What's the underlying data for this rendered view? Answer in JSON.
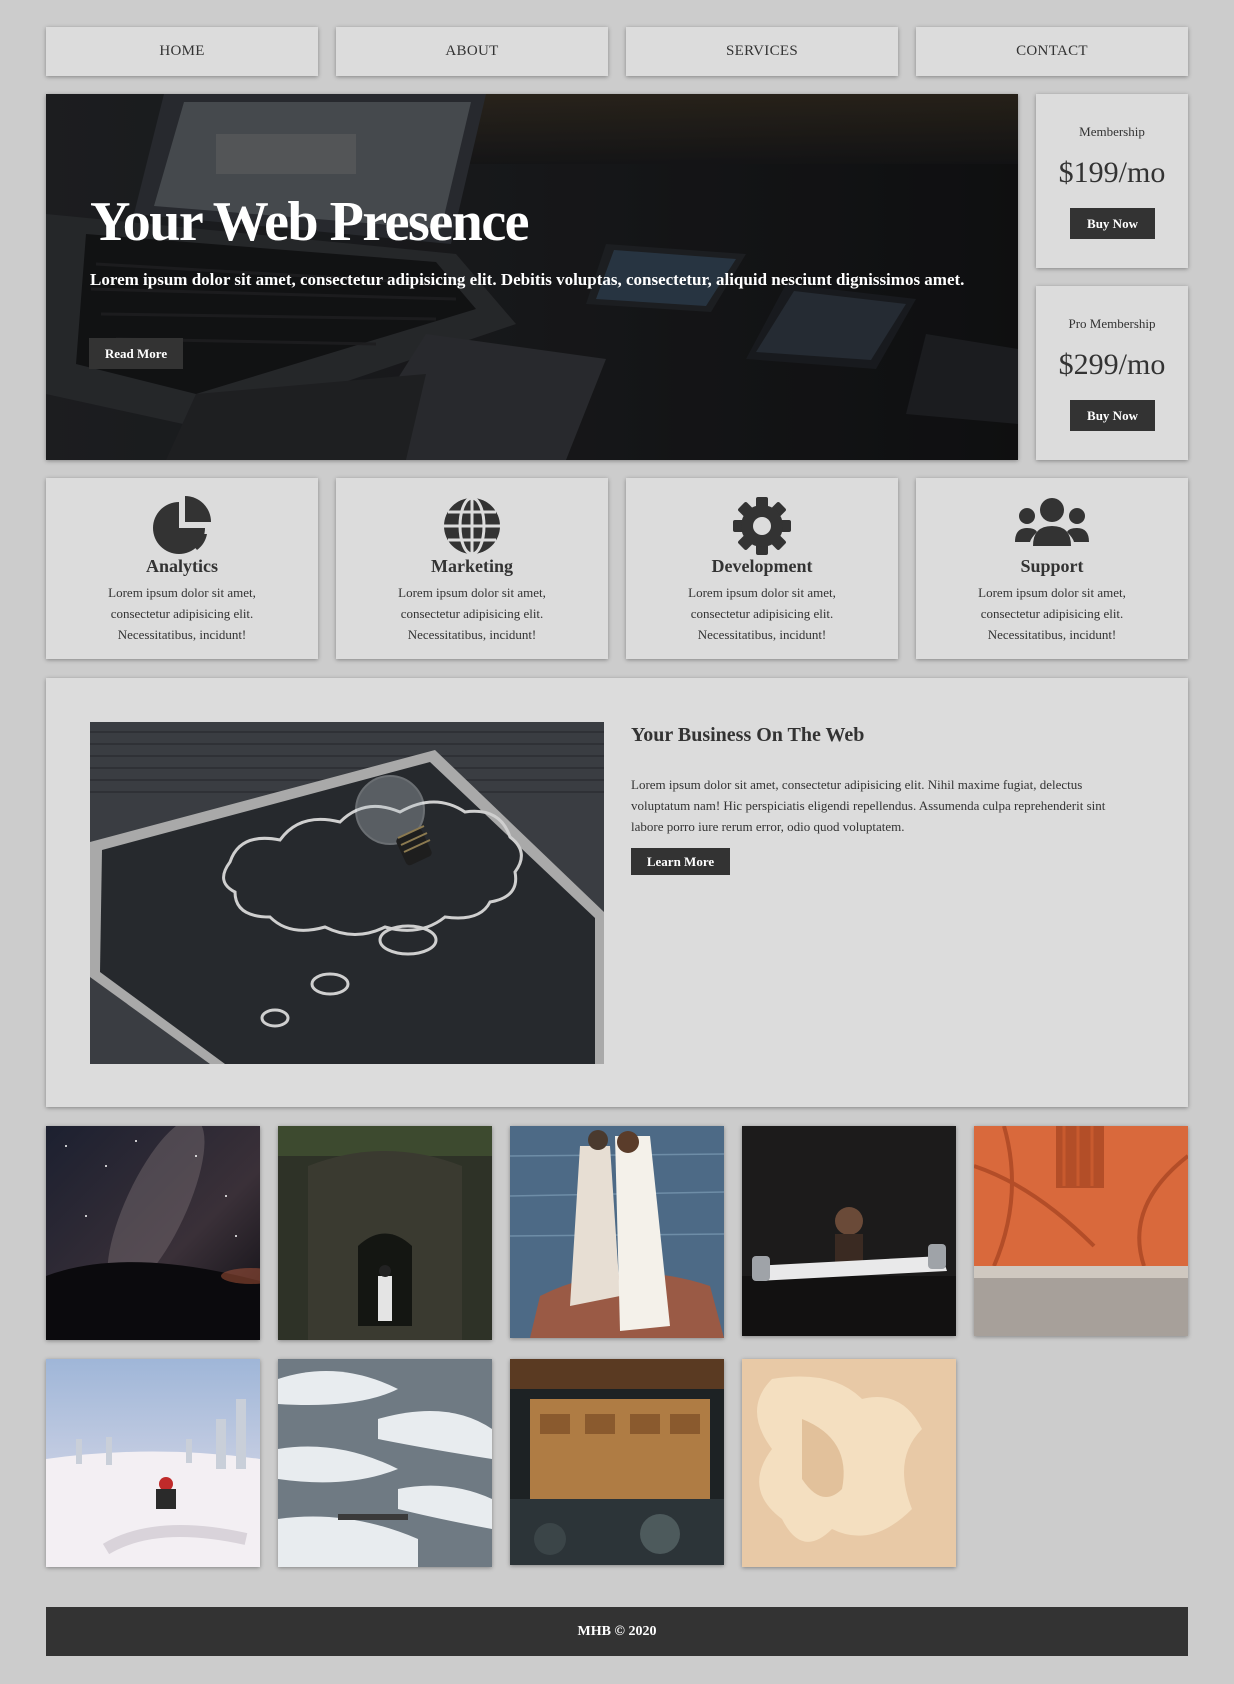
{
  "nav": {
    "items": [
      {
        "label": "HOME"
      },
      {
        "label": "ABOUT"
      },
      {
        "label": "SERVICES"
      },
      {
        "label": "CONTACT"
      }
    ]
  },
  "hero": {
    "title": "Your Web Presence",
    "text": "Lorem ipsum dolor sit amet, consectetur adipisicing elit. Debitis voluptas, consectetur, aliquid nesciunt dignissimos amet.",
    "button_label": "Read More"
  },
  "pricing": [
    {
      "name": "Membership",
      "price": "$199/mo",
      "button_label": "Buy Now"
    },
    {
      "name": "Pro Membership",
      "price": "$299/mo",
      "button_label": "Buy Now"
    }
  ],
  "services": [
    {
      "icon": "chart-pie-icon",
      "title": "Analytics",
      "text": "Lorem ipsum dolor sit amet, consectetur adipisicing elit. Necessitatibus, incidunt!"
    },
    {
      "icon": "globe-icon",
      "title": "Marketing",
      "text": "Lorem ipsum dolor sit amet, consectetur adipisicing elit. Necessitatibus, incidunt!"
    },
    {
      "icon": "cog-icon",
      "title": "Development",
      "text": "Lorem ipsum dolor sit amet, consectetur adipisicing elit. Necessitatibus, incidunt!"
    },
    {
      "icon": "users-icon",
      "title": "Support",
      "text": "Lorem ipsum dolor sit amet, consectetur adipisicing elit. Necessitatibus, incidunt!"
    }
  ],
  "business": {
    "title": "Your Business On The Web",
    "text": "Lorem ipsum dolor sit amet, consectetur adipisicing elit. Nihil maxime fugiat, delectus voluptatum nam! Hic perspiciatis eligendi repellendus. Assumenda culpa reprehenderit sint labore porro iure rerum error, odio quod voluptatem.",
    "button_label": "Learn More"
  },
  "gallery": [
    {
      "subject": "milky-way-night-sky"
    },
    {
      "subject": "person-at-stone-temple"
    },
    {
      "subject": "couple-on-rock-by-water"
    },
    {
      "subject": "man-sitting-dark-room"
    },
    {
      "subject": "orange-wall-tree-shadow"
    },
    {
      "subject": "snowmobile-winter-field"
    },
    {
      "subject": "snow-covered-pine"
    },
    {
      "subject": "night-street-food-stall"
    },
    {
      "subject": "abstract-cream-shape"
    }
  ],
  "colors": {
    "background": "#cccccc",
    "card": "#dcdcdc",
    "dark": "#333333",
    "text": "#333333"
  },
  "footer": {
    "text": "MHB © 2020"
  }
}
